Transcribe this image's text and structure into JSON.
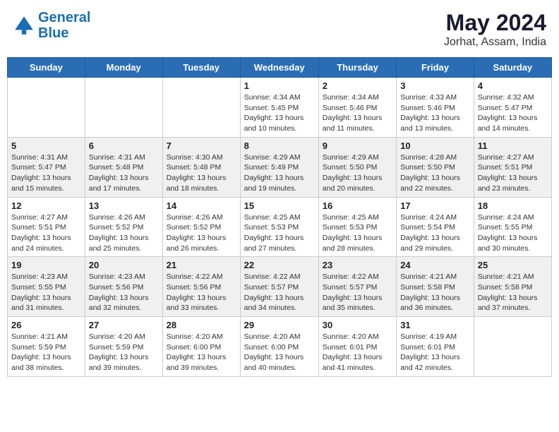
{
  "header": {
    "logo_line1": "General",
    "logo_line2": "Blue",
    "month_year": "May 2024",
    "location": "Jorhat, Assam, India"
  },
  "weekdays": [
    "Sunday",
    "Monday",
    "Tuesday",
    "Wednesday",
    "Thursday",
    "Friday",
    "Saturday"
  ],
  "weeks": [
    [
      {
        "day": "",
        "info": ""
      },
      {
        "day": "",
        "info": ""
      },
      {
        "day": "",
        "info": ""
      },
      {
        "day": "1",
        "info": "Sunrise: 4:34 AM\nSunset: 5:45 PM\nDaylight: 13 hours\nand 10 minutes."
      },
      {
        "day": "2",
        "info": "Sunrise: 4:34 AM\nSunset: 5:46 PM\nDaylight: 13 hours\nand 11 minutes."
      },
      {
        "day": "3",
        "info": "Sunrise: 4:33 AM\nSunset: 5:46 PM\nDaylight: 13 hours\nand 13 minutes."
      },
      {
        "day": "4",
        "info": "Sunrise: 4:32 AM\nSunset: 5:47 PM\nDaylight: 13 hours\nand 14 minutes."
      }
    ],
    [
      {
        "day": "5",
        "info": "Sunrise: 4:31 AM\nSunset: 5:47 PM\nDaylight: 13 hours\nand 15 minutes."
      },
      {
        "day": "6",
        "info": "Sunrise: 4:31 AM\nSunset: 5:48 PM\nDaylight: 13 hours\nand 17 minutes."
      },
      {
        "day": "7",
        "info": "Sunrise: 4:30 AM\nSunset: 5:48 PM\nDaylight: 13 hours\nand 18 minutes."
      },
      {
        "day": "8",
        "info": "Sunrise: 4:29 AM\nSunset: 5:49 PM\nDaylight: 13 hours\nand 19 minutes."
      },
      {
        "day": "9",
        "info": "Sunrise: 4:29 AM\nSunset: 5:50 PM\nDaylight: 13 hours\nand 20 minutes."
      },
      {
        "day": "10",
        "info": "Sunrise: 4:28 AM\nSunset: 5:50 PM\nDaylight: 13 hours\nand 22 minutes."
      },
      {
        "day": "11",
        "info": "Sunrise: 4:27 AM\nSunset: 5:51 PM\nDaylight: 13 hours\nand 23 minutes."
      }
    ],
    [
      {
        "day": "12",
        "info": "Sunrise: 4:27 AM\nSunset: 5:51 PM\nDaylight: 13 hours\nand 24 minutes."
      },
      {
        "day": "13",
        "info": "Sunrise: 4:26 AM\nSunset: 5:52 PM\nDaylight: 13 hours\nand 25 minutes."
      },
      {
        "day": "14",
        "info": "Sunrise: 4:26 AM\nSunset: 5:52 PM\nDaylight: 13 hours\nand 26 minutes."
      },
      {
        "day": "15",
        "info": "Sunrise: 4:25 AM\nSunset: 5:53 PM\nDaylight: 13 hours\nand 27 minutes."
      },
      {
        "day": "16",
        "info": "Sunrise: 4:25 AM\nSunset: 5:53 PM\nDaylight: 13 hours\nand 28 minutes."
      },
      {
        "day": "17",
        "info": "Sunrise: 4:24 AM\nSunset: 5:54 PM\nDaylight: 13 hours\nand 29 minutes."
      },
      {
        "day": "18",
        "info": "Sunrise: 4:24 AM\nSunset: 5:55 PM\nDaylight: 13 hours\nand 30 minutes."
      }
    ],
    [
      {
        "day": "19",
        "info": "Sunrise: 4:23 AM\nSunset: 5:55 PM\nDaylight: 13 hours\nand 31 minutes."
      },
      {
        "day": "20",
        "info": "Sunrise: 4:23 AM\nSunset: 5:56 PM\nDaylight: 13 hours\nand 32 minutes."
      },
      {
        "day": "21",
        "info": "Sunrise: 4:22 AM\nSunset: 5:56 PM\nDaylight: 13 hours\nand 33 minutes."
      },
      {
        "day": "22",
        "info": "Sunrise: 4:22 AM\nSunset: 5:57 PM\nDaylight: 13 hours\nand 34 minutes."
      },
      {
        "day": "23",
        "info": "Sunrise: 4:22 AM\nSunset: 5:57 PM\nDaylight: 13 hours\nand 35 minutes."
      },
      {
        "day": "24",
        "info": "Sunrise: 4:21 AM\nSunset: 5:58 PM\nDaylight: 13 hours\nand 36 minutes."
      },
      {
        "day": "25",
        "info": "Sunrise: 4:21 AM\nSunset: 5:58 PM\nDaylight: 13 hours\nand 37 minutes."
      }
    ],
    [
      {
        "day": "26",
        "info": "Sunrise: 4:21 AM\nSunset: 5:59 PM\nDaylight: 13 hours\nand 38 minutes."
      },
      {
        "day": "27",
        "info": "Sunrise: 4:20 AM\nSunset: 5:59 PM\nDaylight: 13 hours\nand 39 minutes."
      },
      {
        "day": "28",
        "info": "Sunrise: 4:20 AM\nSunset: 6:00 PM\nDaylight: 13 hours\nand 39 minutes."
      },
      {
        "day": "29",
        "info": "Sunrise: 4:20 AM\nSunset: 6:00 PM\nDaylight: 13 hours\nand 40 minutes."
      },
      {
        "day": "30",
        "info": "Sunrise: 4:20 AM\nSunset: 6:01 PM\nDaylight: 13 hours\nand 41 minutes."
      },
      {
        "day": "31",
        "info": "Sunrise: 4:19 AM\nSunset: 6:01 PM\nDaylight: 13 hours\nand 42 minutes."
      },
      {
        "day": "",
        "info": ""
      }
    ]
  ]
}
